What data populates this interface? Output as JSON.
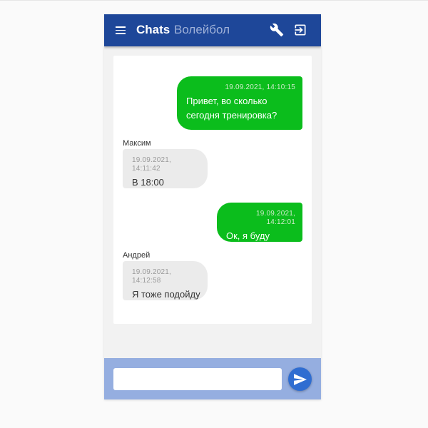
{
  "header": {
    "app_title": "Chats",
    "chat_name": "Волейбол",
    "icons": [
      "menu-icon",
      "wrench-icon",
      "logout-icon"
    ]
  },
  "messages": [
    {
      "direction": "outgoing",
      "sender": "",
      "timestamp": "19.09.2021, 14:10:15",
      "text": "Привет, во сколько сегодня тренировка?"
    },
    {
      "direction": "incoming",
      "sender": "Максим",
      "timestamp": "19.09.2021, 14:11:42",
      "text": "В 18:00"
    },
    {
      "direction": "outgoing",
      "sender": "",
      "timestamp": "19.09.2021, 14:12:01",
      "text": "Ок, я буду"
    },
    {
      "direction": "incoming",
      "sender": "Андрей",
      "timestamp": "19.09.2021, 14:12:58",
      "text": "Я тоже подойду"
    }
  ],
  "composer": {
    "value": "",
    "placeholder": "",
    "send_icon": "send-icon"
  },
  "colors": {
    "appbar": "#1e4799",
    "outgoing_bubble": "#0bbd1c",
    "incoming_bubble": "#ebebeb",
    "composer_bar": "#95aee0",
    "send_button": "#2f6dd1"
  }
}
